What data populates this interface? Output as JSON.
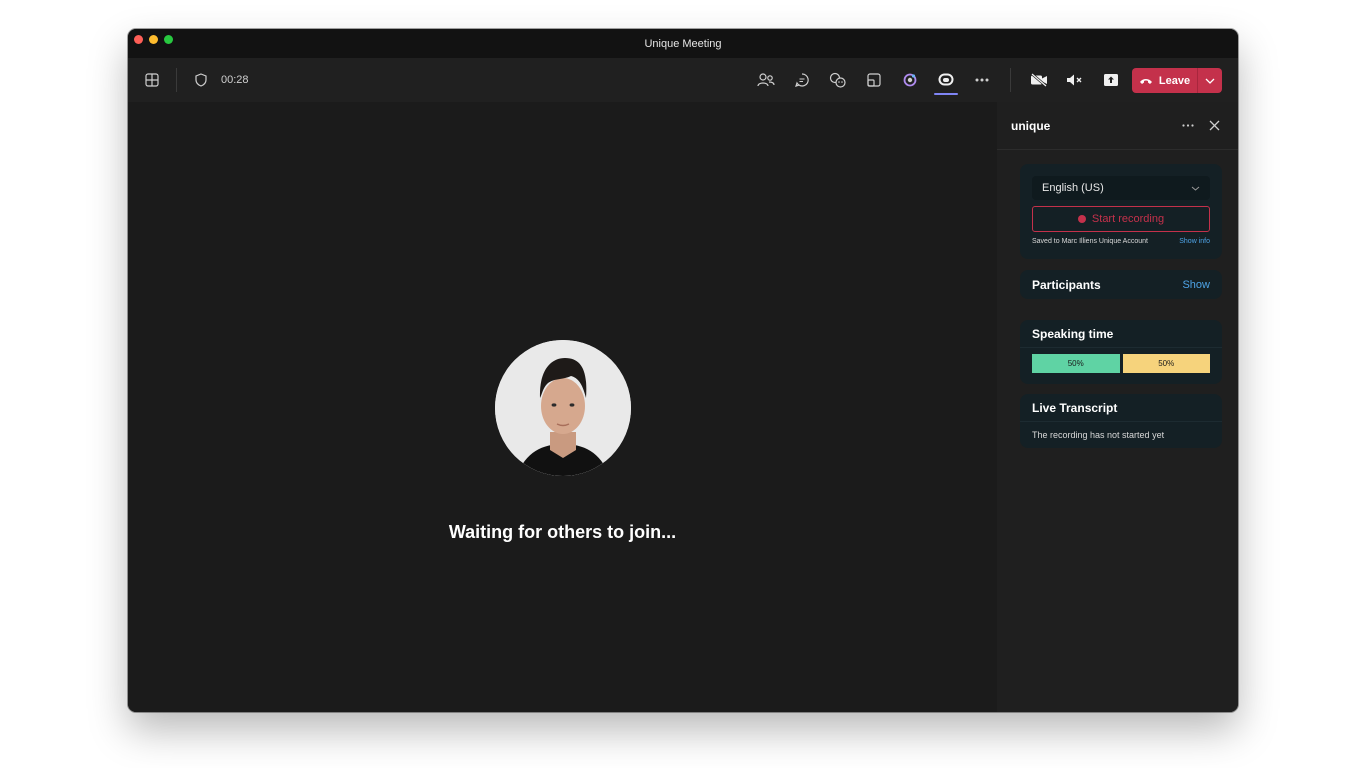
{
  "window": {
    "title": "Unique Meeting"
  },
  "toolbar": {
    "timer": "00:28"
  },
  "leave": {
    "label": "Leave"
  },
  "stage": {
    "waiting_text": "Waiting for others to join..."
  },
  "panel": {
    "title": "unique",
    "language": "English (US)",
    "start_recording": "Start recording",
    "saved_text": "Saved to Marc Illiens Unique Account",
    "show_info": "Show info",
    "participants_title": "Participants",
    "participants_link": "Show",
    "speaking_title": "Speaking time",
    "speaking": [
      {
        "label": "50%",
        "value": 50,
        "color": "#5fd3a4"
      },
      {
        "label": "50%",
        "value": 50,
        "color": "#f6d37c"
      }
    ],
    "transcript_title": "Live Transcript",
    "transcript_text": "The recording has not started yet"
  },
  "icons": [
    "grid-icon",
    "shield-icon",
    "people-icon",
    "chat-icon",
    "reactions-icon",
    "rooms-icon",
    "apps-icon",
    "unique-app-icon",
    "more-icon",
    "camera-off-icon",
    "speaker-mute-icon",
    "share-icon",
    "phone-icon",
    "chevron-down-icon",
    "close-icon"
  ]
}
